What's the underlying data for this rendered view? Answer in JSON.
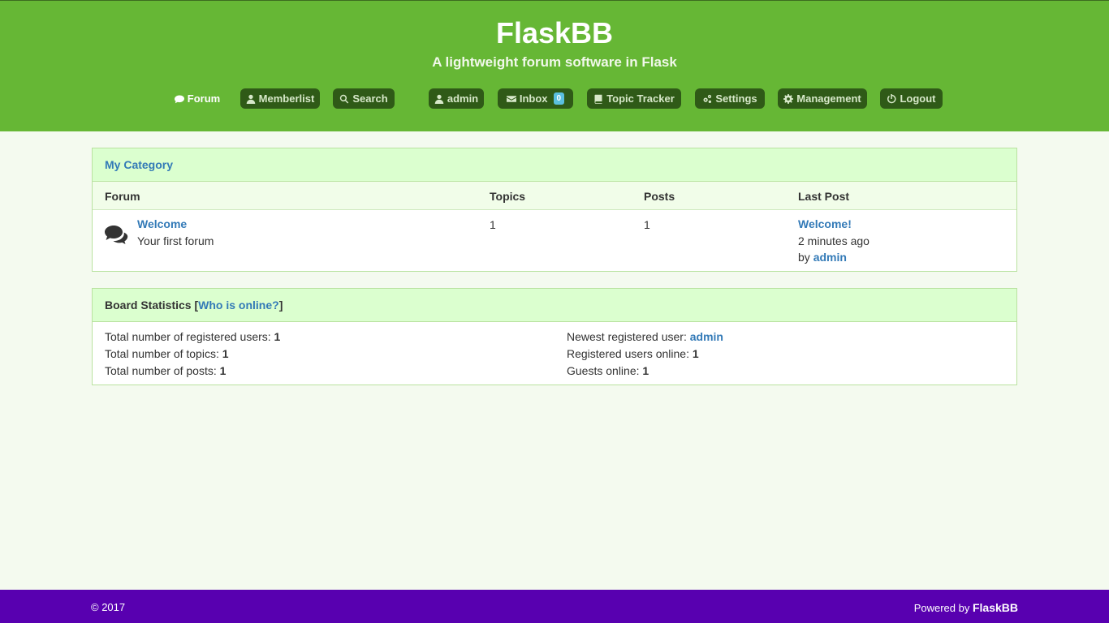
{
  "header": {
    "title": "FlaskBB",
    "subtitle": "A lightweight forum software in Flask"
  },
  "nav": {
    "forum": "Forum",
    "memberlist": "Memberlist",
    "search": "Search",
    "user": "admin",
    "inbox": "Inbox",
    "inbox_count": "0",
    "topic_tracker": "Topic Tracker",
    "settings": "Settings",
    "management": "Management",
    "logout": "Logout"
  },
  "category": {
    "title": "My Category",
    "columns": {
      "forum": "Forum",
      "topics": "Topics",
      "posts": "Posts",
      "last_post": "Last Post"
    },
    "forums": [
      {
        "name": "Welcome",
        "description": "Your first forum",
        "topics": "1",
        "posts": "1",
        "last_post_title": "Welcome!",
        "last_post_time": "2 minutes ago",
        "last_post_by_prefix": "by",
        "last_post_author": "admin"
      }
    ]
  },
  "stats": {
    "title": "Board Statistics",
    "bracket_open": "[",
    "who_online": "Who is online?",
    "bracket_close": "]",
    "registered_users_label": "Total number of registered users:",
    "registered_users": "1",
    "topics_label": "Total number of topics:",
    "topics": "1",
    "posts_label": "Total number of posts:",
    "posts": "1",
    "newest_user_label": "Newest registered user:",
    "newest_user": "admin",
    "users_online_label": "Registered users online:",
    "users_online": "1",
    "guests_online_label": "Guests online:",
    "guests_online": "1"
  },
  "footer": {
    "copyright": "© 2017",
    "powered_by": "Powered by",
    "powered_name": "FlaskBB"
  },
  "colors": {
    "header_bg": "#66b735",
    "nav_button_bg": "#2f5a17",
    "panel_heading_bg": "#dbffcf",
    "footer_bg": "#5800b0",
    "link": "#337ab7",
    "badge": "#5bc0de"
  },
  "icons": {
    "forum": "comment-icon",
    "memberlist": "user-icon",
    "search": "search-icon",
    "user": "user-icon",
    "inbox": "envelope-icon",
    "topic_tracker": "book-icon",
    "settings": "cogs-icon",
    "management": "cog-icon",
    "logout": "power-icon",
    "forum_row": "comments-icon"
  }
}
